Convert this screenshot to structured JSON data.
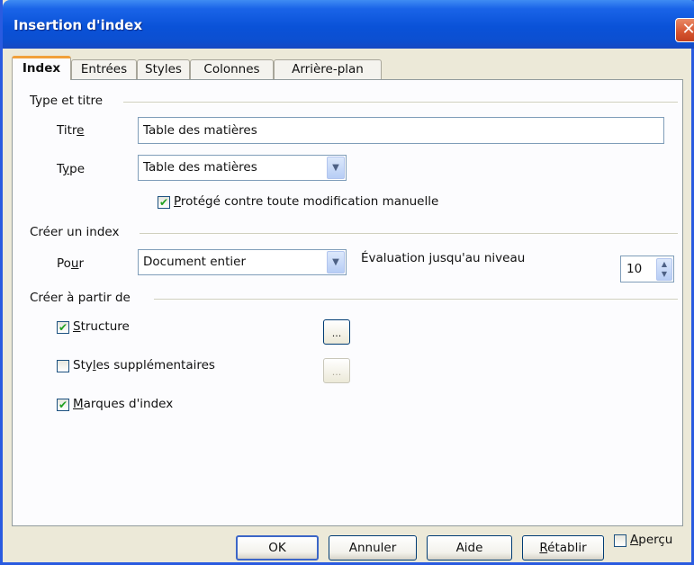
{
  "window": {
    "title": "Insertion d'index",
    "close_glyph": "✕"
  },
  "tabs": [
    {
      "label": "Index",
      "active": true
    },
    {
      "label": "Entrées",
      "active": false
    },
    {
      "label": "Styles",
      "active": false
    },
    {
      "label": "Colonnes",
      "active": false
    },
    {
      "label": "Arrière-plan",
      "active": false
    }
  ],
  "type_section": {
    "heading": "Type et titre",
    "title_label": {
      "pre": "Titr",
      "key": "e",
      "post": ""
    },
    "title_value": "Table des matières",
    "type_label": {
      "pre": "T",
      "key": "y",
      "post": "pe"
    },
    "type_value": "Table des matières",
    "protected_label": {
      "pre": "",
      "key": "P",
      "post": "rotégé contre toute modification manuelle"
    },
    "protected_checked": true
  },
  "create_section": {
    "heading": "Créer un index",
    "for_label": {
      "pre": "Po",
      "key": "u",
      "post": "r"
    },
    "for_value": "Document entier",
    "eval_label": {
      "pre": "Évaluation ",
      "key": "j",
      "post": "usqu'au niveau"
    },
    "eval_value": "10"
  },
  "from_section": {
    "heading": "Créer à partir de",
    "structure": {
      "pre": "",
      "key": "S",
      "post": "tructure",
      "checked": true
    },
    "styles": {
      "pre": "Sty",
      "key": "l",
      "post": "es supplémentaires",
      "checked": false
    },
    "marks": {
      "pre": "",
      "key": "M",
      "post": "arques d'index",
      "checked": true
    },
    "browse_glyph": "..."
  },
  "footer": {
    "ok": "OK",
    "cancel": "Annuler",
    "help": "Aide",
    "reset": {
      "pre": "",
      "key": "R",
      "post": "établir"
    },
    "preview": {
      "pre": "",
      "key": "A",
      "post": "perçu",
      "checked": false
    }
  },
  "icons": {
    "check": "✔",
    "dropdown": "▼",
    "spin_up": "▲",
    "spin_down": "▼"
  },
  "colors": {
    "titlebar": "#0a52d8",
    "tab_accent": "#f1a03a",
    "check_green": "#21a121",
    "close_red": "#d5542f"
  }
}
